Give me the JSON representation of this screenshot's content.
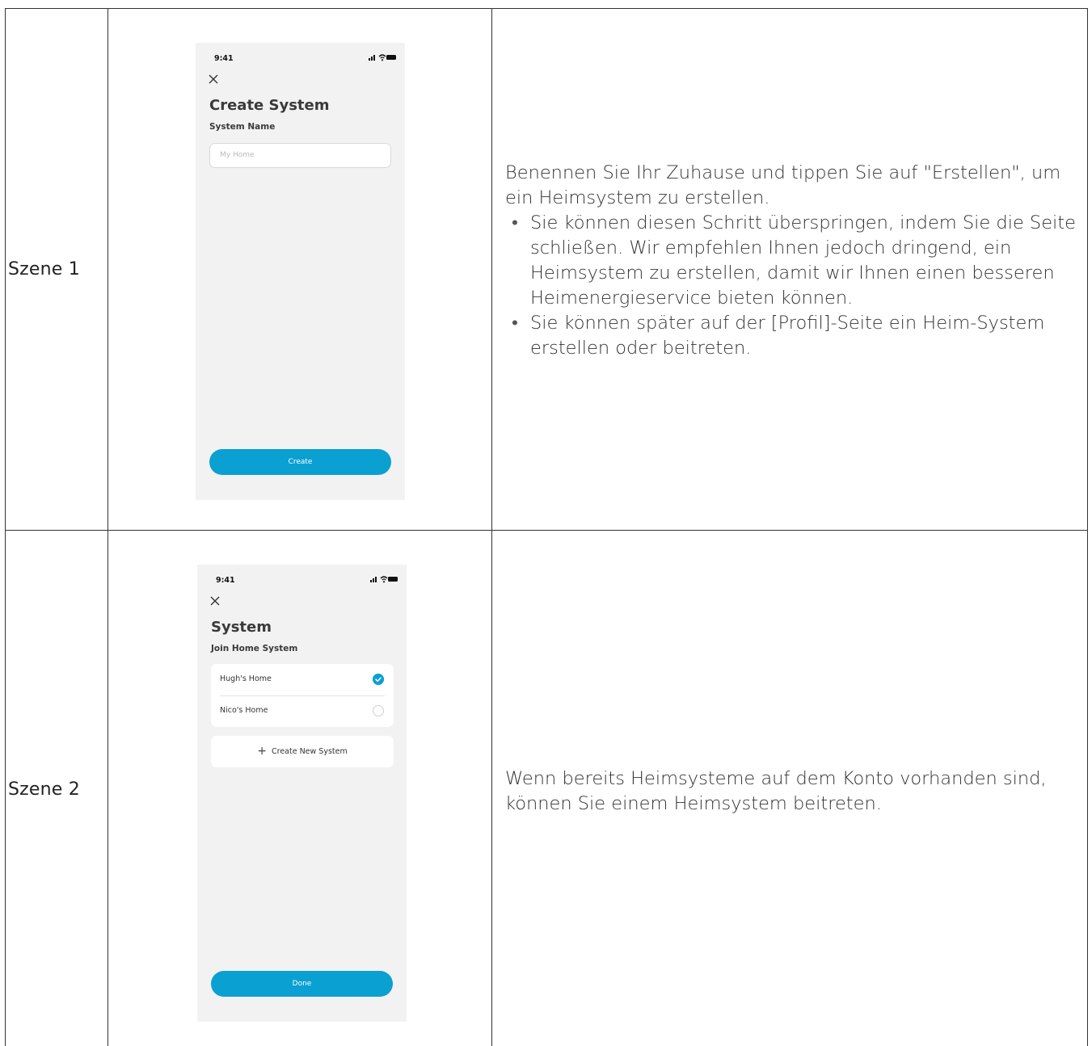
{
  "scenes": [
    {
      "label": "Szene 1",
      "phone": {
        "time": "9:41",
        "title": "Create System",
        "subtitle": "System Name",
        "input_placeholder": "My Home",
        "button_label": "Create"
      },
      "description": {
        "intro": "Benennen Sie Ihr Zuhause und tippen Sie auf \"Erstellen\", um ein Heimsystem zu erstellen.",
        "bullets": [
          "Sie können diesen Schritt überspringen, indem Sie die Seite schließen. Wir empfehlen Ihnen jedoch dringend, ein Heimsystem zu erstellen, damit wir Ihnen einen besseren Heimenergieservice bieten können.",
          "Sie können später auf der [Profil]-Seite ein Heim-System erstellen oder beitreten."
        ]
      }
    },
    {
      "label": "Szene 2",
      "phone": {
        "time": "9:41",
        "title": "System",
        "subtitle": "Join Home System",
        "systems": [
          {
            "name": "Hugh's Home",
            "selected": true
          },
          {
            "name": "Nico's Home",
            "selected": false
          }
        ],
        "create_label": "Create New System",
        "button_label": "Done"
      },
      "description": {
        "intro": "Wenn bereits Heimsysteme auf dem Konto vorhanden sind, können Sie einem Heimsystem beitreten."
      }
    }
  ],
  "colors": {
    "accent": "#0aa0d2",
    "phone_bg": "#f2f2f2",
    "border": "#333333"
  }
}
